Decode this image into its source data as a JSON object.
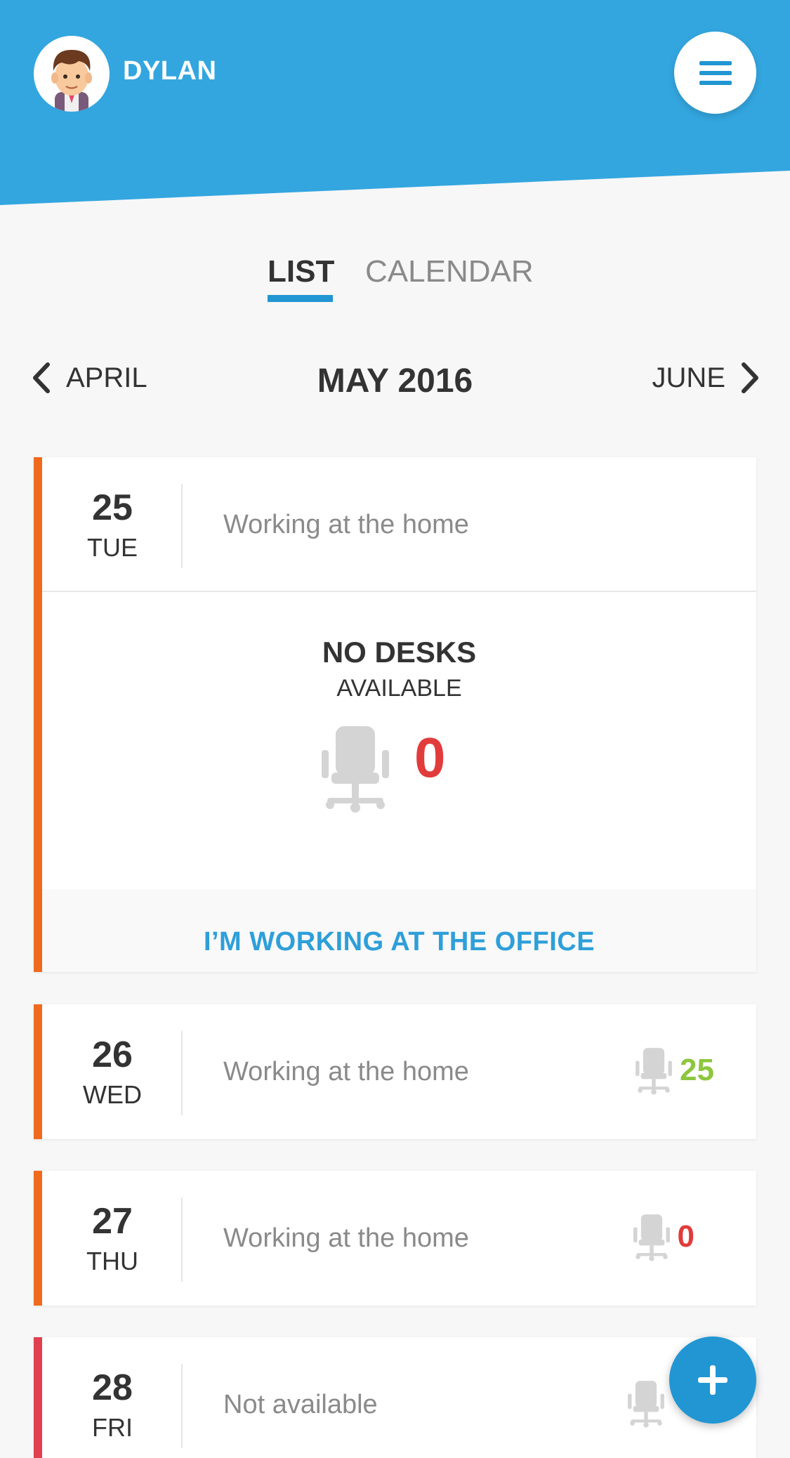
{
  "header": {
    "user_name": "DYLAN",
    "brand_color": "#33a6df",
    "avatar_icon": "boy-avatar-icon",
    "menu_icon": "hamburger-menu-icon"
  },
  "tabs": [
    {
      "label": "LIST",
      "active": true
    },
    {
      "label": "CALENDAR",
      "active": false
    }
  ],
  "month_nav": {
    "prev_label": "APRIL",
    "current_label": "MAY 2016",
    "next_label": "JUNE"
  },
  "colors": {
    "stripe_working_home": "#f06a1e",
    "stripe_not_available": "#e04050",
    "count_zero": "#e23b3b",
    "count_positive": "#8dc63f",
    "accent": "#2e9fd9"
  },
  "days": [
    {
      "date": "25",
      "weekday": "TUE",
      "status": "Working at the home",
      "expanded": true
    },
    {
      "date": "26",
      "weekday": "WED",
      "status": "Working at the home",
      "desks": "25"
    },
    {
      "date": "27",
      "weekday": "THU",
      "status": "Working at the home",
      "desks": "0"
    },
    {
      "date": "28",
      "weekday": "FRI",
      "status": "Not available"
    }
  ],
  "expanded_day": {
    "title": "NO DESKS",
    "subtitle": "AVAILABLE",
    "desk_count": "0",
    "action_label": "I’M WORKING AT THE OFFICE"
  },
  "fab_icon": "plus-icon"
}
